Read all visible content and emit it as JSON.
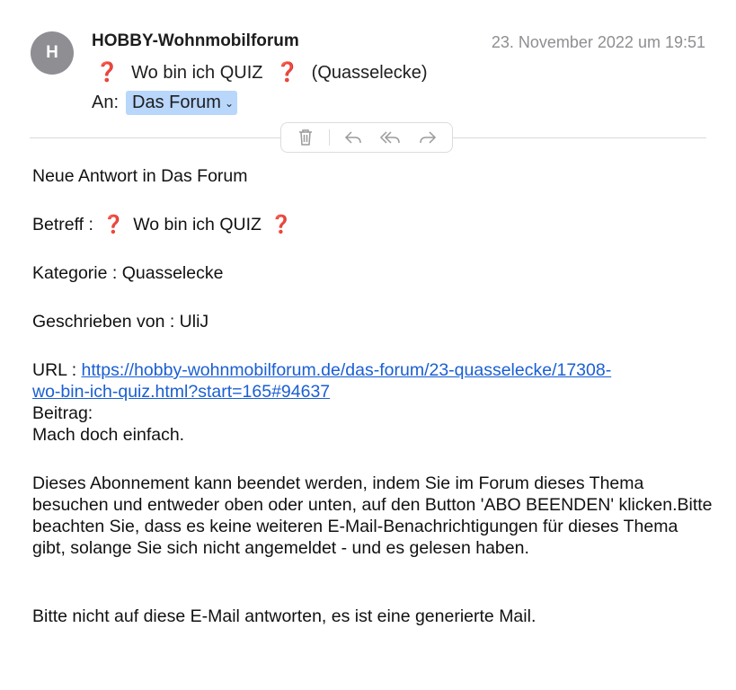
{
  "header": {
    "avatar_initial": "H",
    "sender": "HOBBY-Wohnmobilforum",
    "date": "23. November 2022 um 19:51",
    "subject_prefix_mark": "❓",
    "subject_text": "Wo bin ich QUIZ",
    "subject_suffix_mark": "❓",
    "subject_category": "(Quasselecke)",
    "to_label": "An:",
    "recipient": "Das Forum"
  },
  "toolbar": {
    "icons": [
      "trash-icon",
      "reply-icon",
      "reply-all-icon",
      "forward-icon"
    ]
  },
  "body": {
    "line_new_reply": "Neue Antwort in Das Forum",
    "subject_label": "Betreff :",
    "subject_mark": "❓",
    "subject_text": "Wo bin ich QUIZ",
    "category": "Kategorie : Quasselecke",
    "author": "Geschrieben von : UliJ",
    "url_label": "URL :",
    "url_line1": "https://hobby-wohnmobilforum.de/das-forum/23-quasselecke/17308-",
    "url_line2": "wo-bin-ich-quiz.html?start=165#94637",
    "post_label": "Beitrag:",
    "post_text": "Mach doch einfach.",
    "unsubscribe_text": "Dieses Abonnement kann beendet werden, indem Sie im Forum dieses Thema besuchen und entweder oben oder unten, auf den Button 'ABO BEENDEN' klicken.Bitte beachten Sie, dass es keine weiteren E-Mail-Benachrichtigungen für dieses Thema gibt, solange Sie sich nicht angemeldet - und es gelesen haben.",
    "no_reply_text": "Bitte nicht auf diese E-Mail antworten, es ist eine generierte Mail."
  },
  "colors": {
    "question_mark": "#d2232a",
    "link": "#1a5fd3",
    "recipient_highlight": "#b9d6fb",
    "avatar_bg": "#8e8e93"
  }
}
